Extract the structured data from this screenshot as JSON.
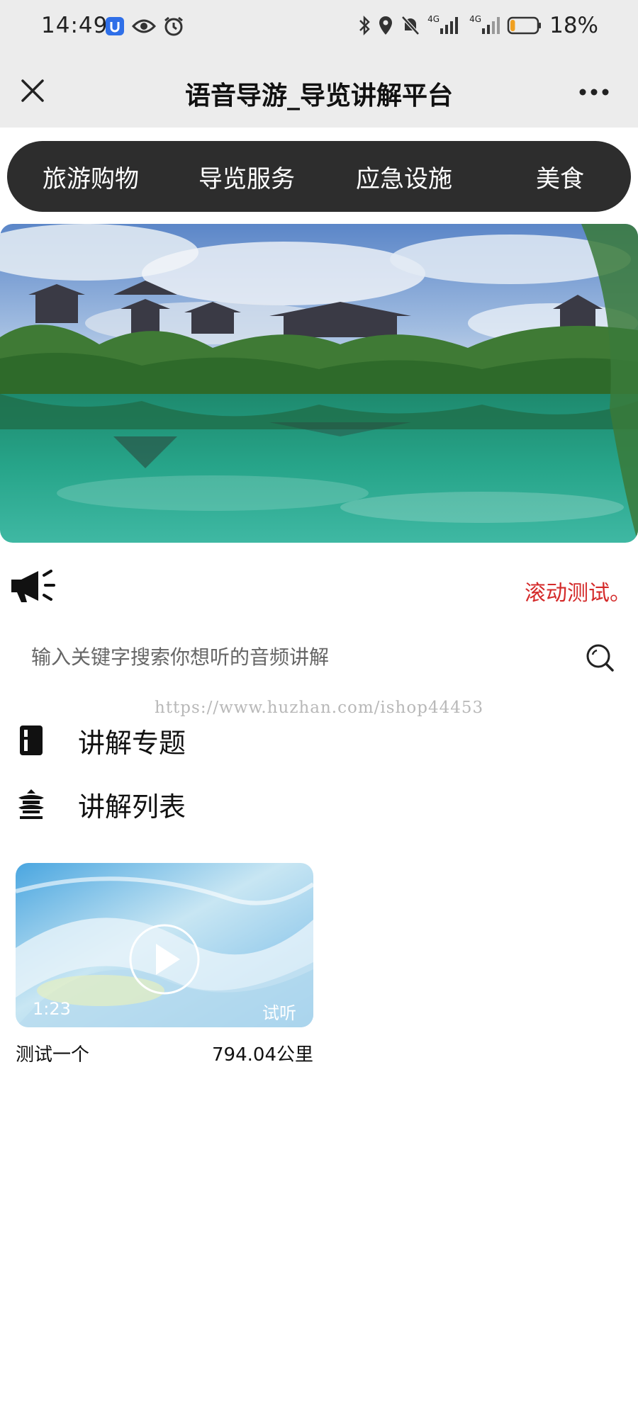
{
  "status_bar": {
    "time": "14:49",
    "signal_1": "4G",
    "signal_2": "4G",
    "battery_percent": "18%",
    "battery_level": 0.18,
    "icons": [
      "app-badge-icon",
      "eye-icon",
      "alarm-icon",
      "bluetooth-icon",
      "location-icon",
      "mute-bell-icon",
      "signal-icon",
      "battery-icon"
    ]
  },
  "title_bar": {
    "title": "语音导游_导览讲解平台"
  },
  "categories": [
    {
      "label": "旅游购物"
    },
    {
      "label": "导览服务"
    },
    {
      "label": "应急设施"
    },
    {
      "label": "美食"
    }
  ],
  "notice": {
    "text": "滚动测试。",
    "color": "#d42a2a"
  },
  "search": {
    "placeholder": "输入关键字搜索你想听的音频讲解"
  },
  "watermark": "https://www.huzhan.com/ishop44453",
  "sections": {
    "topics": "讲解专题",
    "list": "讲解列表"
  },
  "audio_items": [
    {
      "title": "测试一个",
      "distance": "794.04公里",
      "duration": "1:23",
      "preview_label": "试听"
    }
  ],
  "colors": {
    "header_bg": "#ececec",
    "nav_bg": "#2d2d2d",
    "nav_text": "#ffffff",
    "notice_red": "#d42a2a"
  }
}
